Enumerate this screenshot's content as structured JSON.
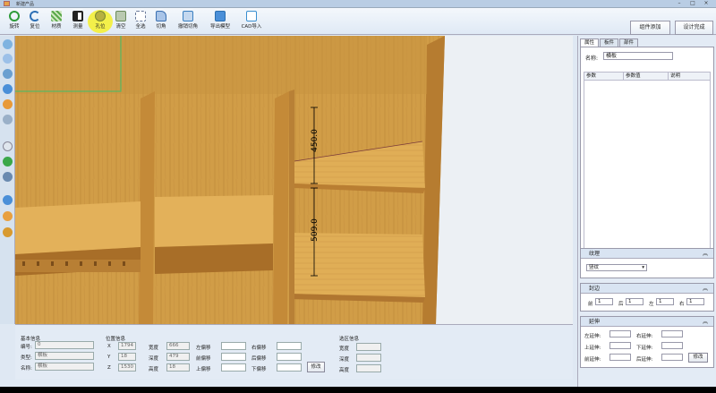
{
  "window": {
    "title": "新建产品"
  },
  "toolbar": {
    "buttons": [
      {
        "label": "旋转",
        "icon": "rotate-icon",
        "color": "#2e9b3a"
      },
      {
        "label": "复位",
        "icon": "reset-icon",
        "color": "#2d6fb5"
      },
      {
        "label": "材质",
        "icon": "texture-icon",
        "color": "#5aa84a"
      },
      {
        "label": "测量",
        "icon": "measure-icon",
        "color": "#222222"
      },
      {
        "label": "孔位",
        "icon": "hole-icon",
        "color": "#7a8a30"
      },
      {
        "label": "清空",
        "icon": "clear-icon",
        "color": "#6a8a5a"
      },
      {
        "label": "全选",
        "icon": "select-all-icon",
        "color": "#6a7a9a"
      },
      {
        "label": "切角",
        "icon": "cut-corner-icon",
        "color": "#3a6fb0"
      },
      {
        "label": "撤销切角",
        "icon": "undo-cut-icon",
        "color": "#3a7fc0"
      },
      {
        "label": "导出模型",
        "icon": "export-icon",
        "color": "#2a7fd0"
      },
      {
        "label": "CAD导入",
        "icon": "cad-import-icon",
        "color": "#3a8fd0"
      }
    ],
    "right_buttons": [
      "组件添加",
      "设计完成"
    ]
  },
  "viewport": {
    "dim_upper": "450.0",
    "dim_lower": "509.0"
  },
  "props": {
    "tabs": [
      "属性",
      "板件",
      "部件"
    ],
    "name_label": "名称:",
    "name_value": "横板",
    "columns": [
      "参数",
      "参数值",
      "说明"
    ]
  },
  "texture": {
    "header": "纹理",
    "value": "竖纹"
  },
  "edge": {
    "header": "封边",
    "labels": [
      "前",
      "后",
      "左",
      "右"
    ],
    "values": [
      "1",
      "1",
      "1",
      "1"
    ]
  },
  "extend": {
    "header": "延伸",
    "labels": [
      "左延伸:",
      "右延伸:",
      "上延伸:",
      "下延伸:",
      "前延伸:",
      "后延伸:"
    ],
    "button": "修改"
  },
  "basic": {
    "title": "基本信息",
    "rows": [
      {
        "label": "编号:",
        "value": "0"
      },
      {
        "label": "类型:",
        "value": "横板"
      },
      {
        "label": "名称:",
        "value": "横板"
      }
    ]
  },
  "position": {
    "title": "位置信息",
    "axes": [
      {
        "axis": "X",
        "value": "1794",
        "dim": "宽度",
        "dim_value": "666",
        "offset": "左偏移",
        "offset2": "右偏移"
      },
      {
        "axis": "Y",
        "value": "18",
        "dim": "深度",
        "dim_value": "479",
        "offset": "前偏移",
        "offset2": "后偏移"
      },
      {
        "axis": "Z",
        "value": "1530",
        "dim": "高度",
        "dim_value": "18",
        "offset": "上偏移",
        "offset2": "下偏移"
      }
    ],
    "button": "修改"
  },
  "choice": {
    "title": "选区信息",
    "rows": [
      "宽度",
      "深度",
      "高度"
    ]
  }
}
